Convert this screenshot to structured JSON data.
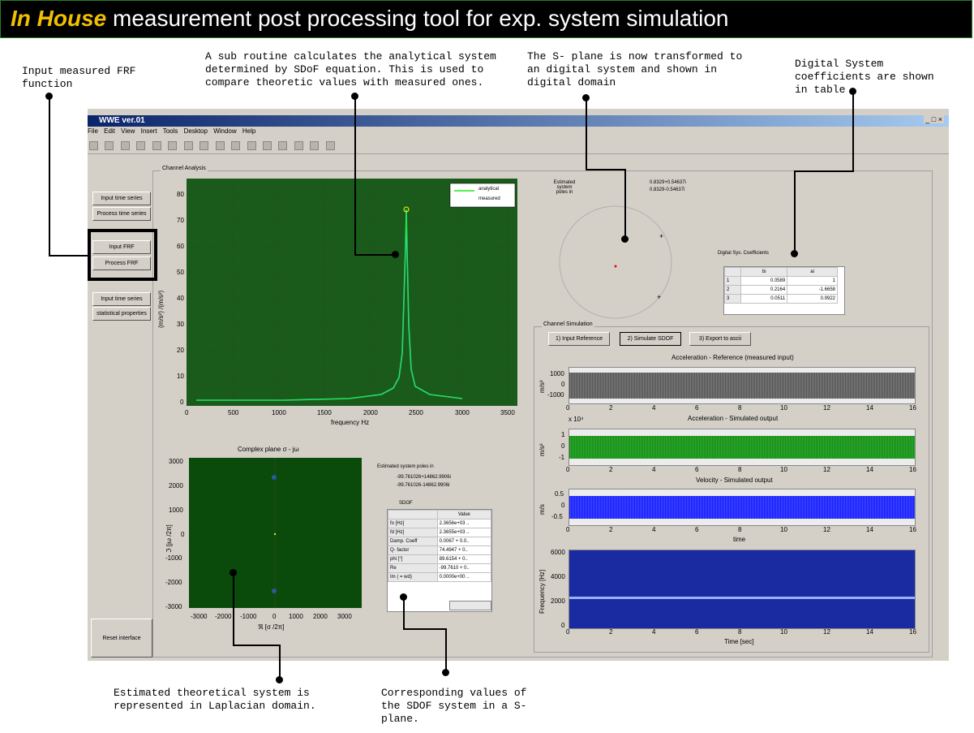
{
  "header": {
    "title_em": "In House",
    "title_rest": " measurement post processing tool for exp. system simulation"
  },
  "annotations": {
    "a1": "Input measured FRF\nfunction",
    "a2": "A sub routine calculates the analytical system\ndetermined by SDoF equation. This is used to\ncompare theoretic values with measured ones.",
    "a3": "The S- plane is now transformed to\nan digital system and shown in\ndigital domain",
    "a4": "Digital System\ncoefficients are shown\nin table",
    "a5": "Estimated theoretical system is\nrepresented in Laplacian domain.",
    "a6": "Corresponding values of\nthe SDOF system in a S-\nplane."
  },
  "window": {
    "title": "WWE ver.01",
    "menu": [
      "File",
      "Edit",
      "View",
      "Insert",
      "Tools",
      "Desktop",
      "Window",
      "Help"
    ],
    "controls": "_ □ ×"
  },
  "left_buttons": {
    "input_time_series": "Input time series",
    "process_time_series": "Process time series",
    "input_frf": "Input FRF",
    "process_frf": "Process FRF",
    "input_time_series2": "Input time series",
    "statistical_properties": "statistical properties",
    "reset": "Reset interface"
  },
  "channel_analysis": {
    "label": "Channel Analysis",
    "frf_plot": {
      "legend": [
        "analytical",
        "measured"
      ],
      "ylabel": "(m/s²) /(m/s²)",
      "xlabel": "frequency Hz",
      "yticks": [
        "80",
        "70",
        "60",
        "50",
        "40",
        "30",
        "20",
        "10",
        "0"
      ],
      "xticks": [
        "0",
        "500",
        "1000",
        "1500",
        "2000",
        "2500",
        "3000",
        "3500"
      ]
    },
    "complex_plot": {
      "title": "Complex plane σ - jω",
      "ylabel": "ℑ [jω /2π]",
      "xlabel": "ℜ [σ /2π]",
      "yticks": [
        "3000",
        "2000",
        "1000",
        "0",
        "-1000",
        "-2000",
        "-3000"
      ],
      "xticks": [
        "-3000",
        "-2000",
        "-1000",
        "0",
        "1000",
        "2000",
        "3000"
      ]
    }
  },
  "poles": {
    "label": "Estimated system poles in",
    "p1": "-99.761026+14862.9906i",
    "p2": "-99.761026-14862.9906i"
  },
  "sdof": {
    "label": "SDOF",
    "col": "Value",
    "rows": [
      [
        "fo [Hz]",
        "2.3656e+03 .."
      ],
      [
        "fd [Hz]",
        "2.3655e+03 .."
      ],
      [
        "Damp. Coeff",
        "0.0067 + 0.0.."
      ],
      [
        "Q- factor",
        "74.4947 + 0.."
      ],
      [
        "phi [°]",
        "89.6154 + 0.."
      ],
      [
        "Re",
        "-99.7610 + 0.."
      ],
      [
        "Im ( = wd)",
        "0.0000e+00 .."
      ]
    ]
  },
  "digital": {
    "est_label": "Estimated\nsystem\npoles in",
    "z1": "0.8329+0.54637i",
    "z2": "0.8329-0.54637i",
    "coeff_title": "Digital Sys. Coefficients",
    "cols": [
      "bi",
      "ai"
    ],
    "rows": [
      [
        "1",
        "0.0589",
        "1"
      ],
      [
        "2",
        "0.2164",
        "-1.6658"
      ],
      [
        "3",
        "0.0511",
        "0.9922"
      ]
    ]
  },
  "simulation": {
    "label": "Channel Simulation",
    "b1": "1) Input Reference",
    "b2": "2) Simulate SDOF",
    "b3": "3) Export to ascii",
    "p1_title": "Acceleration - Reference (measured input)",
    "p1_ylabel": "m/s²",
    "p1_yticks": [
      "1000",
      "0",
      "-1000"
    ],
    "p2_title": "Acceleration - Simulated output",
    "p2_exp": "x 10⁴",
    "p2_ylabel": "m/s²",
    "p2_yticks": [
      "1",
      "0",
      "-1"
    ],
    "p3_title": "Velocity - Simulated output",
    "p3_ylabel": "m/s",
    "p3_yticks": [
      "0.5",
      "0",
      "-0.5"
    ],
    "p3_xlabel": "time",
    "p4_ylabel": "Frequency [Hz]",
    "p4_yticks": [
      "6000",
      "4000",
      "2000",
      "0"
    ],
    "p4_xlabel": "Time [sec]",
    "xticks": [
      "0",
      "2",
      "4",
      "6",
      "8",
      "10",
      "12",
      "14",
      "16"
    ],
    "colors": {
      "ref": "#555555",
      "acc": "#1a8a1a",
      "vel": "#1a1aff",
      "spec": "#1a2aa0"
    }
  }
}
